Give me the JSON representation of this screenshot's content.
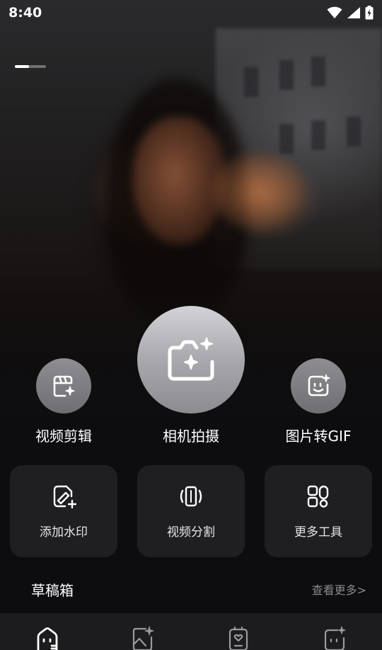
{
  "status_bar": {
    "time": "8:40",
    "icons": [
      "wifi-icon",
      "cellular-icon",
      "battery-charging-icon"
    ]
  },
  "page_indicator": {
    "total": 2,
    "active": 1
  },
  "primary_actions": [
    {
      "id": "video-edit",
      "label": "视频剪辑",
      "icon": "clapperboard-sparkle-icon"
    },
    {
      "id": "camera",
      "label": "相机拍摄",
      "icon": "camera-sparkle-icon"
    },
    {
      "id": "image-to-gif",
      "label": "图片转GIF",
      "icon": "sticker-face-icon"
    }
  ],
  "tool_cards": [
    {
      "id": "add-watermark",
      "label": "添加水印",
      "icon": "watermark-edit-icon"
    },
    {
      "id": "video-split",
      "label": "视频分割",
      "icon": "split-video-icon"
    },
    {
      "id": "more-tools",
      "label": "更多工具",
      "icon": "grid-apps-icon"
    }
  ],
  "drafts": {
    "title": "草稿箱",
    "more_label": "查看更多>"
  },
  "bottom_nav": [
    {
      "id": "home",
      "icon": "home-face-icon",
      "active": true
    },
    {
      "id": "photos",
      "icon": "image-sparkle-icon",
      "active": false
    },
    {
      "id": "templates",
      "icon": "heart-card-icon",
      "active": false
    },
    {
      "id": "profile",
      "icon": "smile-sparkle-icon",
      "active": false
    }
  ],
  "colors": {
    "background": "#0d0d0f",
    "card": "#1f1f21",
    "nav": "#1c1c1e",
    "muted_text": "#8a8a8e"
  }
}
